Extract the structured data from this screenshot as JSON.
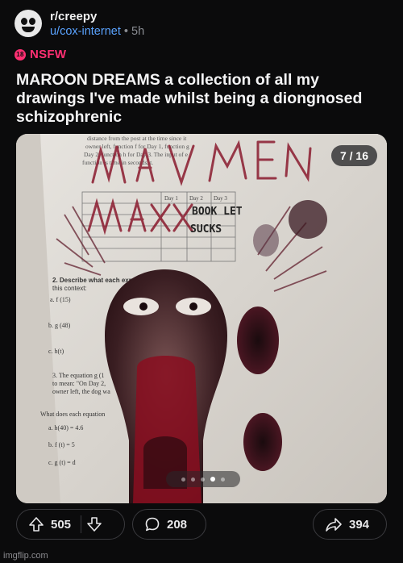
{
  "post": {
    "subreddit": "r/creepy",
    "username": "u/cox-internet",
    "separator": "•",
    "age": "5h",
    "nsfw_label": "NSFW",
    "nsfw_badge_text": "18",
    "title": "MAROON DREAMS a collection of all my drawings I've made whilst being a diongnosed schizophrenic"
  },
  "gallery": {
    "counter": "7 / 16",
    "current": 7,
    "total": 16,
    "worksheet_text": {
      "word1": "distance from the post at the time since it",
      "word2": "owner left, function f for Day 1, function g",
      "word3": "Day 2, function h for Day 3. The input of e",
      "word4": "function is time in seconds, t.",
      "table_day1": "Day 1",
      "table_day2": "Day 2",
      "table_day3": "Day 3",
      "q2": "2. Describe what each expression represents in",
      "q2b": "this context:",
      "a_f15": "a. f (15)",
      "b_g48": "b. g (48)",
      "c_ht": "c. h(t)",
      "q3": "3. The equation g (1",
      "q3b": "to mean: \"On Day 2,",
      "q3c": "owner left, the dog wa",
      "what": "What does each equation",
      "h40": "a. h(40) = 4.6",
      "ft5": "b. f (t) = 5",
      "gtd": "c. g (t) = d",
      "book": "BOOK LET",
      "sucks": "SUCKS"
    }
  },
  "actions": {
    "upvotes": "505",
    "comments": "208",
    "shares": "394"
  },
  "watermark": "imgflip.com",
  "colors": {
    "background": "#0b0b0c",
    "accent_user": "#5aa3ff",
    "nsfw": "#ff2f72",
    "border": "#3a3a3e"
  }
}
